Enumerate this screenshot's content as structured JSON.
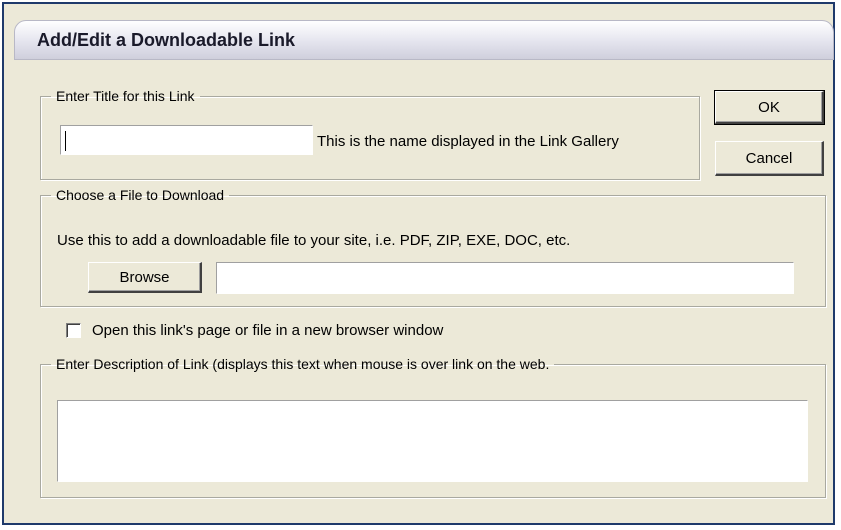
{
  "window": {
    "title": "Add/Edit a Downloadable Link"
  },
  "title_group": {
    "legend": "Enter Title for this Link",
    "input_value": "",
    "hint": "This is the name displayed in the Link Gallery"
  },
  "buttons": {
    "ok": "OK",
    "cancel": "Cancel"
  },
  "file_group": {
    "legend": "Choose a File to Download",
    "instructions": "Use this to add a downloadable file to your site, i.e. PDF, ZIP, EXE, DOC, etc.",
    "browse_label": "Browse",
    "path_value": ""
  },
  "new_window": {
    "label": "Open this link's page or file in a new browser window",
    "checked": false
  },
  "description_group": {
    "legend": "Enter Description of Link (displays this text when mouse is over link on the web.",
    "value": ""
  }
}
